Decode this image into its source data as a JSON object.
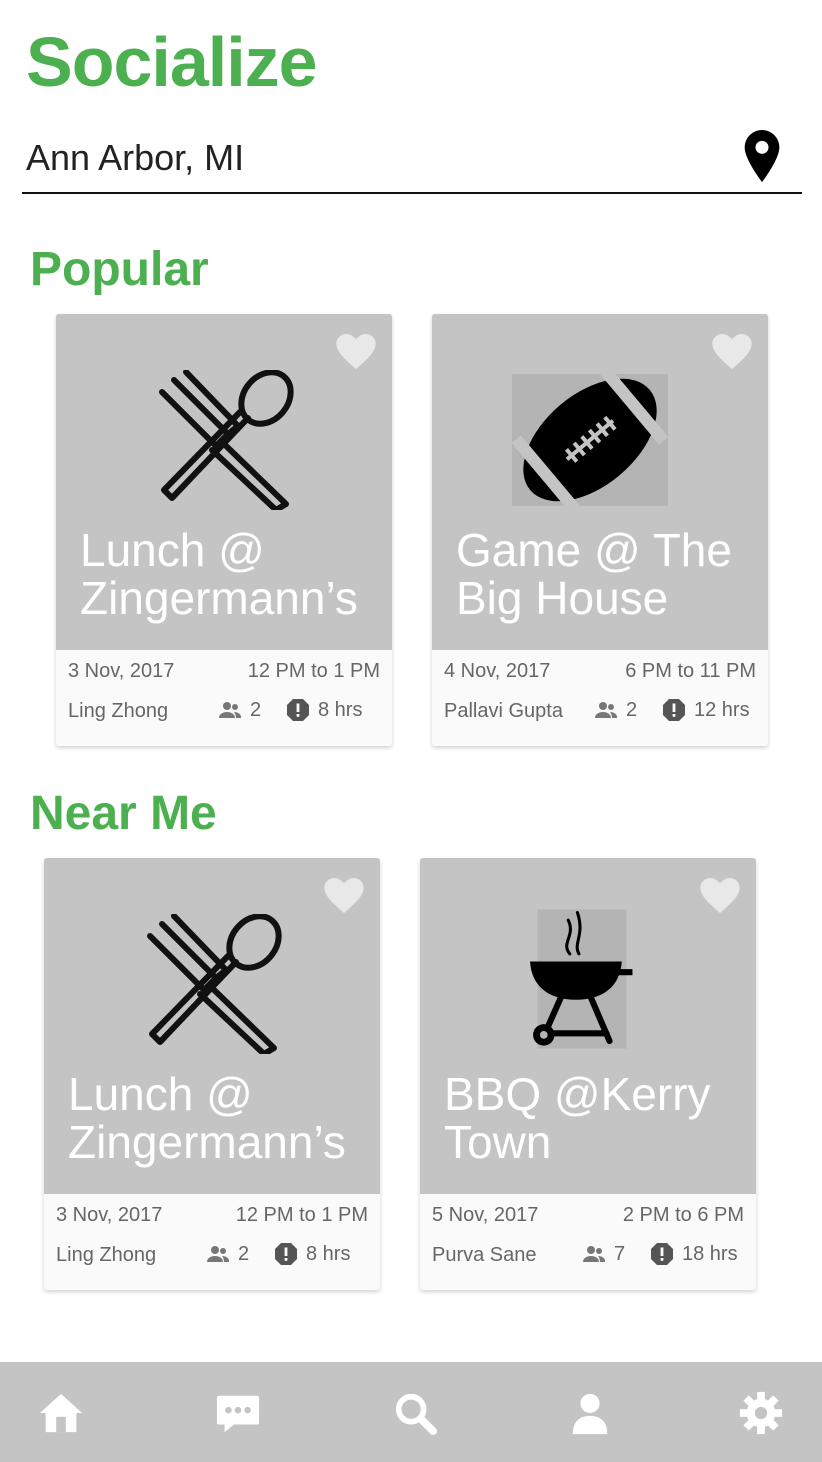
{
  "app": {
    "title": "Socialize",
    "accent_color": "#4caf50"
  },
  "location": {
    "value": "Ann Arbor, MI",
    "icon": "map-pin-icon"
  },
  "sections": {
    "popular": {
      "title": "Popular",
      "cards": [
        {
          "title": "Lunch @ Zingermann’s",
          "date": "3 Nov, 2017",
          "time": "12 PM to 1 PM",
          "host": "Ling Zhong",
          "attendees": "2",
          "time_left": "8 hrs",
          "illustration": "fork-spoon-icon"
        },
        {
          "title": "Game @ The Big House",
          "date": "4 Nov, 2017",
          "time": "6 PM to 11 PM",
          "host": "Pallavi Gupta",
          "attendees": "2",
          "time_left": "12 hrs",
          "illustration": "football-icon"
        }
      ]
    },
    "near_me": {
      "title": "Near Me",
      "cards": [
        {
          "title": "Lunch @ Zingermann’s",
          "date": "3 Nov, 2017",
          "time": "12 PM to 1 PM",
          "host": "Ling Zhong",
          "attendees": "2",
          "time_left": "8 hrs",
          "illustration": "fork-spoon-icon"
        },
        {
          "title": "BBQ @Kerry Town",
          "date": "5 Nov, 2017",
          "time": "2 PM to 6 PM",
          "host": "Purva Sane",
          "attendees": "7",
          "time_left": "18 hrs",
          "illustration": "grill-icon"
        }
      ]
    }
  },
  "nav": [
    "home-icon",
    "chat-icon",
    "search-icon",
    "profile-icon",
    "settings-icon"
  ]
}
